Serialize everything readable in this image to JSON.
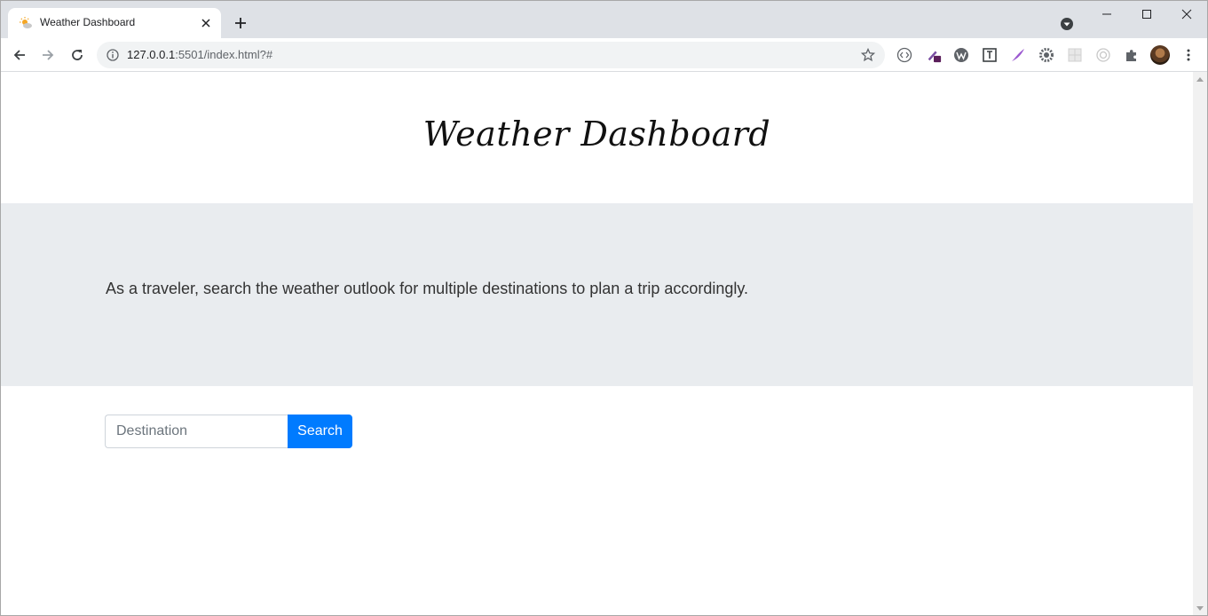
{
  "browser": {
    "tab_title": "Weather Dashboard",
    "url_host": "127.0.0.1",
    "url_rest": ":5501/index.html?#"
  },
  "page": {
    "title": "Weather Dashboard",
    "lead_text": "As a traveler, search the weather outlook for multiple destinations to plan a trip accordingly.",
    "search": {
      "placeholder": "Destination",
      "button_label": "Search"
    }
  },
  "colors": {
    "primary": "#007bff",
    "jumbotron_bg": "#e9ecef"
  }
}
